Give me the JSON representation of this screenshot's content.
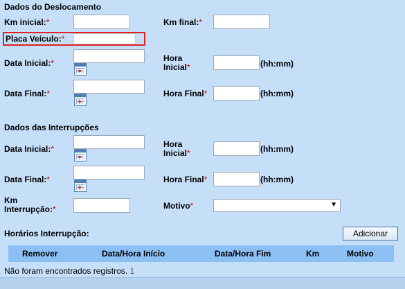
{
  "sections": {
    "deslocamento_title": "Dados do Deslocamento",
    "interrupcoes_title": "Dados das Interrupções",
    "horarios_title": "Horários Interrupção:"
  },
  "deslocamento": {
    "km_inicial_label": "Km inicial:",
    "km_final_label": "Km final:",
    "placa_label": "Placa Veículo:",
    "data_inicial_label": "Data Inicial:",
    "hora_inicial_label_1": "Hora",
    "hora_inicial_label_2": "Inicial",
    "hhmm_1": "(hh:mm)",
    "data_final_label": "Data Final:",
    "hora_final_label": "Hora Final",
    "hhmm_2": "(hh:mm)"
  },
  "interrupcoes": {
    "data_inicial_label": "Data Inicial:",
    "hora_inicial_label_1": "Hora",
    "hora_inicial_label_2": "Inicial",
    "hhmm_1": "(hh:mm)",
    "data_final_label": "Data Final:",
    "hora_final_label": "Hora Final",
    "hhmm_2": "(hh:mm)",
    "km_interrupcao_label_1": "Km",
    "km_interrupcao_label_2": "Interrupção:",
    "motivo_label": "Motivo",
    "motivo_selected": ""
  },
  "required_mark": "*",
  "add_button_label": "Adicionar",
  "table": {
    "columns": [
      "Remover",
      "Data/Hora Início",
      "Data/Hora Fim",
      "Km",
      "Motivo"
    ],
    "empty_message": "Não foram encontrados registros.",
    "page_number": "1"
  },
  "colors": {
    "background": "#c6dff9",
    "table_header": "#8cc0f5",
    "required": "#cc0000",
    "highlight": "#e02020"
  }
}
